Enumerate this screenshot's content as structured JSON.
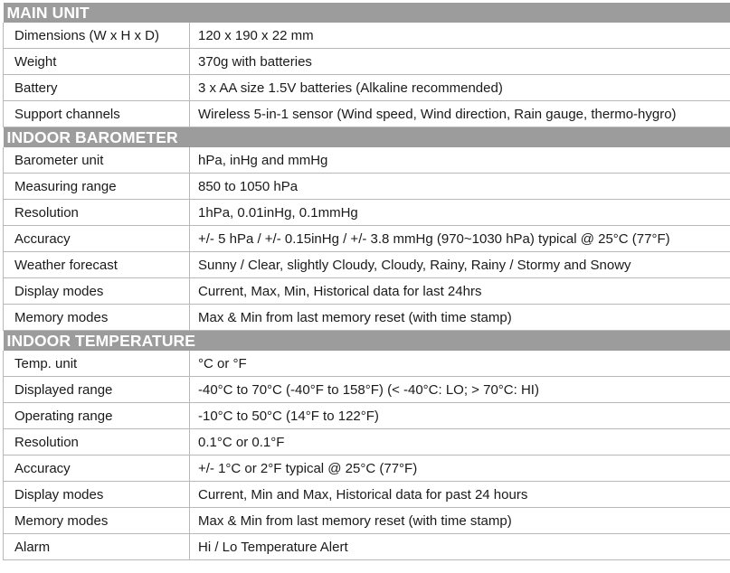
{
  "sections": [
    {
      "title": "MAIN UNIT",
      "rows": [
        {
          "label": "Dimensions (W x H x D)",
          "value": "120 x 190 x 22 mm"
        },
        {
          "label": "Weight",
          "value": "370g with batteries"
        },
        {
          "label": "Battery",
          "value": "3 x AA size 1.5V batteries (Alkaline recommended)"
        },
        {
          "label": "Support channels",
          "value": "Wireless 5-in-1 sensor (Wind speed, Wind direction, Rain gauge, thermo-hygro)"
        }
      ]
    },
    {
      "title": "INDOOR BAROMETER",
      "rows": [
        {
          "label": "Barometer unit",
          "value": "hPa, inHg and mmHg"
        },
        {
          "label": "Measuring range",
          "value": "850 to 1050 hPa"
        },
        {
          "label": "Resolution",
          "value": "1hPa, 0.01inHg, 0.1mmHg"
        },
        {
          "label": "Accuracy",
          "value": "+/- 5 hPa / +/- 0.15inHg / +/- 3.8 mmHg (970~1030 hPa) typical @ 25°C (77°F)"
        },
        {
          "label": "Weather forecast",
          "value": "Sunny / Clear, slightly Cloudy, Cloudy, Rainy, Rainy / Stormy and Snowy"
        },
        {
          "label": "Display modes",
          "value": "Current, Max, Min, Historical data for last 24hrs"
        },
        {
          "label": "Memory modes",
          "value": "Max & Min from last memory reset  (with time stamp)"
        }
      ]
    },
    {
      "title": "INDOOR TEMPERATURE",
      "rows": [
        {
          "label": "Temp. unit",
          "value": " °C or °F"
        },
        {
          "label": "Displayed range",
          "value": "-40°C to 70°C (-40°F to 158°F) (< -40°C: LO; > 70°C: HI)"
        },
        {
          "label": "Operating range",
          "value": "-10°C to 50°C (14°F to 122°F)"
        },
        {
          "label": "Resolution",
          "value": "0.1°C or 0.1°F"
        },
        {
          "label": "Accuracy",
          "value": "+/- 1°C or 2°F typical @ 25°C (77°F)"
        },
        {
          "label": "Display modes",
          "value": "Current, Min and Max, Historical data for past 24 hours"
        },
        {
          "label": "Memory modes",
          "value": "Max & Min from last memory reset  (with time stamp)"
        },
        {
          "label": "Alarm",
          "value": "Hi / Lo Temperature Alert"
        }
      ]
    }
  ]
}
